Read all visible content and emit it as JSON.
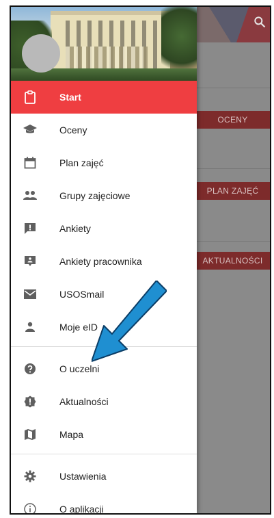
{
  "background": {
    "buttons": [
      "OCENY",
      "PLAN ZAJĘĆ",
      "AKTUALNOŚCI"
    ],
    "search_icon": "search-icon"
  },
  "drawer": {
    "items": [
      {
        "label": "Start",
        "icon": "clipboard-icon",
        "active": true
      },
      {
        "label": "Oceny",
        "icon": "graduation-cap-icon"
      },
      {
        "label": "Plan zajęć",
        "icon": "calendar-icon"
      },
      {
        "label": "Grupy zajęciowe",
        "icon": "group-icon"
      },
      {
        "label": "Ankiety",
        "icon": "feedback-icon"
      },
      {
        "label": "Ankiety pracownika",
        "icon": "employee-feedback-icon"
      },
      {
        "label": "USOSmail",
        "icon": "mail-icon"
      },
      {
        "label": "Moje eID",
        "icon": "person-icon"
      },
      {
        "label": "O uczelni",
        "icon": "help-icon"
      },
      {
        "label": "Aktualności",
        "icon": "announcement-icon"
      },
      {
        "label": "Mapa",
        "icon": "map-icon"
      },
      {
        "label": "Ustawienia",
        "icon": "settings-icon"
      },
      {
        "label": "O aplikacji",
        "icon": "info-icon"
      }
    ]
  },
  "colors": {
    "accent": "#ef3e41",
    "annotation_arrow": "#1f8fd1"
  }
}
